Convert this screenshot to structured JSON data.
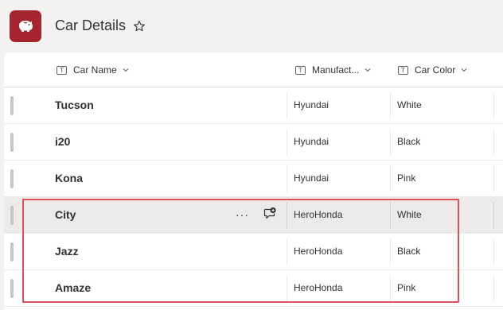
{
  "header": {
    "title": "Car Details",
    "app_icon": "piggy-bank-icon",
    "favorite_icon": "star-icon",
    "accent": "#a4262c"
  },
  "columns": [
    {
      "label": "Car Name"
    },
    {
      "label": "Manufact..."
    },
    {
      "label": "Car Color"
    }
  ],
  "rows": [
    {
      "name": "Tucson",
      "manufacturer": "Hyundai",
      "color": "White"
    },
    {
      "name": "i20",
      "manufacturer": "Hyundai",
      "color": "Black"
    },
    {
      "name": "Kona",
      "manufacturer": "Hyundai",
      "color": "Pink"
    },
    {
      "name": "City",
      "manufacturer": "HeroHonda",
      "color": "White"
    },
    {
      "name": "Jazz",
      "manufacturer": "HeroHonda",
      "color": "Black"
    },
    {
      "name": "Amaze",
      "manufacturer": "HeroHonda",
      "color": "Pink"
    }
  ],
  "hover_row_actions": {
    "more": "···",
    "comment_icon": "comment-add-icon"
  },
  "highlight_color": "#e0505a"
}
